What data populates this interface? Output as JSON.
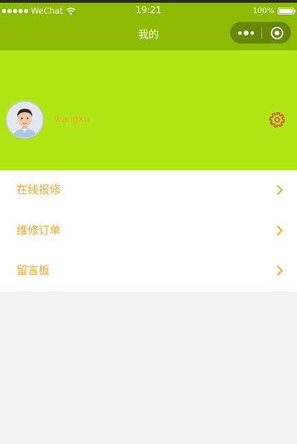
{
  "status_bar": {
    "carrier": "WeChat",
    "time": "19:21",
    "battery": "100%",
    "battery_level": 1.0
  },
  "nav": {
    "title": "我的"
  },
  "icons": {
    "signal": "signal-dots-icon",
    "wifi": "wifi-icon",
    "battery": "battery-icon",
    "more": "more-dots-icon",
    "close": "capsule-close-icon",
    "settings": "gear-icon",
    "chevron": "chevron-right-icon"
  },
  "colors": {
    "nav_bg": "#8dbb04",
    "header_bg": "#b0e616",
    "accent": "#f5a623",
    "settings_icon": "#e0431b",
    "page_bg": "#f1f1f1"
  },
  "profile": {
    "username": "wangxu"
  },
  "menu": {
    "items": [
      {
        "label": "在线报修"
      },
      {
        "label": "维修订单"
      },
      {
        "label": "留言板"
      }
    ]
  }
}
